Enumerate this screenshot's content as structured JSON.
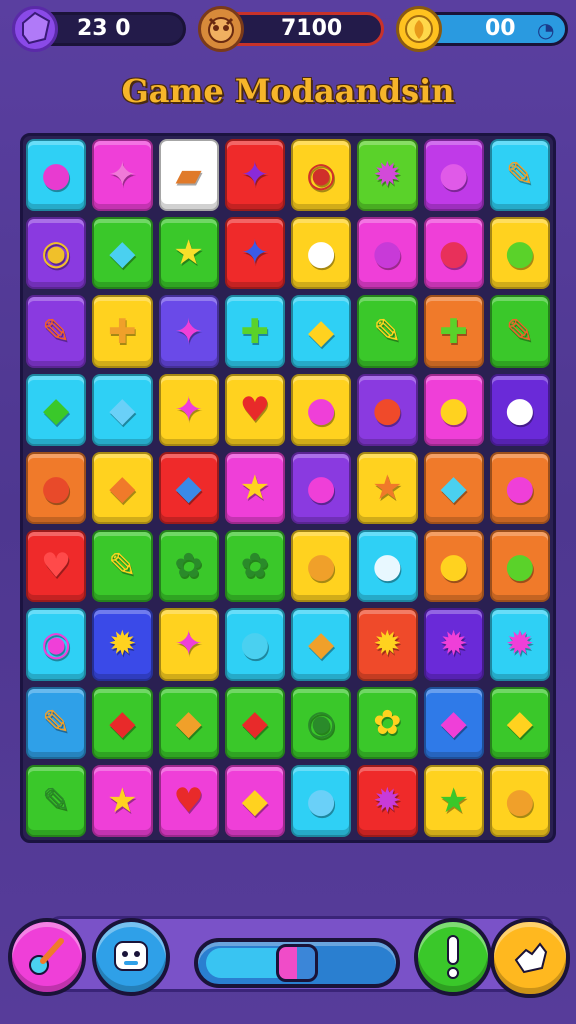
{
  "hud": {
    "left_value": "23 0",
    "center_value": "7100",
    "right_value": "00",
    "left_icon": "puzzle-piece-icon",
    "center_icon": "owl-badge-icon",
    "right_icon": "gold-coin-icon"
  },
  "title": "Game Modaandsin",
  "board": {
    "rows": [
      [
        {
          "c": "#2fd0f5",
          "g": "●",
          "gc": "#e83bd0"
        },
        {
          "c": "#ef3fd8",
          "g": "✦",
          "gc": "#f07ad8"
        },
        {
          "c": "#ffffff",
          "g": "▰",
          "gc": "#e07a2a"
        },
        {
          "c": "#ef2a2a",
          "g": "✦",
          "gc": "#8a2ad8"
        },
        {
          "c": "#ffd21f",
          "g": "◉",
          "gc": "#d0302a"
        },
        {
          "c": "#5ad22a",
          "g": "✹",
          "gc": "#d24ad8"
        },
        {
          "c": "#c03ae8",
          "g": "●",
          "gc": "#e05ae8"
        },
        {
          "c": "#2fd0f5",
          "g": "✎",
          "gc": "#f0a02a"
        }
      ],
      [
        {
          "c": "#8a3ae0",
          "g": "◉",
          "gc": "#f0c02a"
        },
        {
          "c": "#3ac82a",
          "g": "◆",
          "gc": "#4ad0f0"
        },
        {
          "c": "#3ac82a",
          "g": "★",
          "gc": "#f8e02a"
        },
        {
          "c": "#ef2a2a",
          "g": "✦",
          "gc": "#3a5ae8"
        },
        {
          "c": "#ffd21f",
          "g": "●",
          "gc": "#ffffff"
        },
        {
          "c": "#ef3fd8",
          "g": "●",
          "gc": "#c83ad8"
        },
        {
          "c": "#ef3fd8",
          "g": "●",
          "gc": "#e8305a"
        },
        {
          "c": "#ffd21f",
          "g": "●",
          "gc": "#5ad22a"
        }
      ],
      [
        {
          "c": "#8a3ae0",
          "g": "✎",
          "gc": "#f0602a"
        },
        {
          "c": "#ffd21f",
          "g": "✚",
          "gc": "#f0a02a"
        },
        {
          "c": "#6a4ae8",
          "g": "✦",
          "gc": "#ef3fd8"
        },
        {
          "c": "#2fd0f5",
          "g": "✚",
          "gc": "#5ad22a"
        },
        {
          "c": "#2fd0f5",
          "g": "◆",
          "gc": "#ffd21f"
        },
        {
          "c": "#3ac82a",
          "g": "✎",
          "gc": "#ffd21f"
        },
        {
          "c": "#f07a2a",
          "g": "✚",
          "gc": "#5ad22a"
        },
        {
          "c": "#3ac82a",
          "g": "✎",
          "gc": "#f0602a"
        }
      ],
      [
        {
          "c": "#2fd0f5",
          "g": "◆",
          "gc": "#3ac82a"
        },
        {
          "c": "#2fd0f5",
          "g": "◆",
          "gc": "#6ad0f8"
        },
        {
          "c": "#ffd21f",
          "g": "✦",
          "gc": "#ef3fd8"
        },
        {
          "c": "#ffd21f",
          "g": "♥",
          "gc": "#e82a2a"
        },
        {
          "c": "#ffd21f",
          "g": "●",
          "gc": "#ef3fd8"
        },
        {
          "c": "#8a3ae0",
          "g": "●",
          "gc": "#f04a2a"
        },
        {
          "c": "#ef3fd8",
          "g": "●",
          "gc": "#ffd21f"
        },
        {
          "c": "#6a2ad8",
          "g": "●",
          "gc": "#ffffff"
        }
      ],
      [
        {
          "c": "#f07a2a",
          "g": "●",
          "gc": "#e84a2a"
        },
        {
          "c": "#ffd21f",
          "g": "◆",
          "gc": "#f07a2a"
        },
        {
          "c": "#ef2a2a",
          "g": "◆",
          "gc": "#3a8ae8"
        },
        {
          "c": "#ef3fd8",
          "g": "★",
          "gc": "#ffd21f"
        },
        {
          "c": "#8a3ae0",
          "g": "●",
          "gc": "#ef3fd8"
        },
        {
          "c": "#ffd21f",
          "g": "★",
          "gc": "#f07a2a"
        },
        {
          "c": "#f07a2a",
          "g": "◆",
          "gc": "#4ad0f0"
        },
        {
          "c": "#f07a2a",
          "g": "●",
          "gc": "#ef3fd8"
        }
      ],
      [
        {
          "c": "#ef2a2a",
          "g": "♥",
          "gc": "#ff4a4a"
        },
        {
          "c": "#3ac82a",
          "g": "✎",
          "gc": "#ffd21f"
        },
        {
          "c": "#3ac82a",
          "g": "✿",
          "gc": "#2a8a2a"
        },
        {
          "c": "#3ac82a",
          "g": "✿",
          "gc": "#2a8a2a"
        },
        {
          "c": "#ffd21f",
          "g": "●",
          "gc": "#f0a02a"
        },
        {
          "c": "#2fd0f5",
          "g": "●",
          "gc": "#e8f8ff"
        },
        {
          "c": "#f07a2a",
          "g": "●",
          "gc": "#ffd21f"
        },
        {
          "c": "#f07a2a",
          "g": "●",
          "gc": "#5ad22a"
        }
      ],
      [
        {
          "c": "#2fd0f5",
          "g": "◉",
          "gc": "#ef3fd8"
        },
        {
          "c": "#3a4ae8",
          "g": "✹",
          "gc": "#ffd21f"
        },
        {
          "c": "#ffd21f",
          "g": "✦",
          "gc": "#ef3fd8"
        },
        {
          "c": "#2fd0f5",
          "g": "●",
          "gc": "#4ad0f0"
        },
        {
          "c": "#2fd0f5",
          "g": "◆",
          "gc": "#f0a02a"
        },
        {
          "c": "#ef4a2a",
          "g": "✹",
          "gc": "#ffd21f"
        },
        {
          "c": "#6a2ad8",
          "g": "✹",
          "gc": "#ef3fd8"
        },
        {
          "c": "#2fd0f5",
          "g": "✹",
          "gc": "#ef3fd8"
        }
      ],
      [
        {
          "c": "#2fa0e8",
          "g": "✎",
          "gc": "#f0a02a"
        },
        {
          "c": "#3ac82a",
          "g": "◆",
          "gc": "#e82a2a"
        },
        {
          "c": "#3ac82a",
          "g": "◆",
          "gc": "#f0a02a"
        },
        {
          "c": "#3ac82a",
          "g": "◆",
          "gc": "#e82a2a"
        },
        {
          "c": "#3ac82a",
          "g": "◉",
          "gc": "#2a8a2a"
        },
        {
          "c": "#3ac82a",
          "g": "✿",
          "gc": "#ffd21f"
        },
        {
          "c": "#2f7ae8",
          "g": "◆",
          "gc": "#ef3fd8"
        },
        {
          "c": "#3ac82a",
          "g": "◆",
          "gc": "#ffd21f"
        }
      ],
      [
        {
          "c": "#3ac82a",
          "g": "✎",
          "gc": "#2a8a2a"
        },
        {
          "c": "#ef3fd8",
          "g": "★",
          "gc": "#ffd21f"
        },
        {
          "c": "#ef3fd8",
          "g": "♥",
          "gc": "#e82a2a"
        },
        {
          "c": "#ef3fd8",
          "g": "◆",
          "gc": "#ffd21f"
        },
        {
          "c": "#2fd0f5",
          "g": "●",
          "gc": "#6ad0f8"
        },
        {
          "c": "#ef2a2a",
          "g": "✹",
          "gc": "#c83ad8"
        },
        {
          "c": "#ffd21f",
          "g": "★",
          "gc": "#3ac82a"
        },
        {
          "c": "#ffd21f",
          "g": "●",
          "gc": "#f0a02a"
        }
      ]
    ]
  },
  "controls": {
    "brush_icon": "paint-brush-icon",
    "robot_icon": "robot-face-icon",
    "hint_icon": "exclamation-icon",
    "hand_icon": "hand-pointer-icon",
    "slider_level": 0.5
  }
}
